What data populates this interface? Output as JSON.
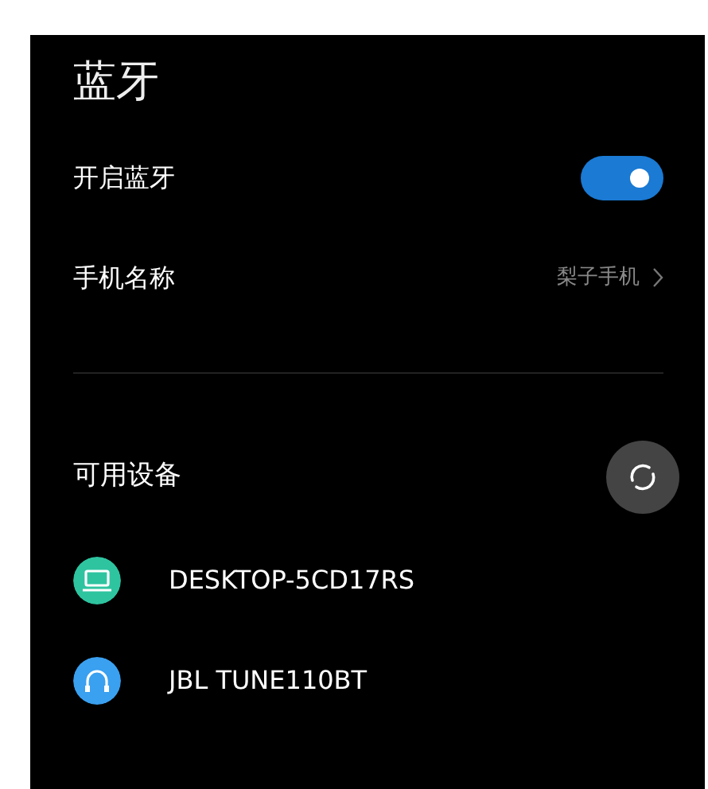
{
  "title": "蓝牙",
  "bluetooth": {
    "label": "开启蓝牙",
    "on": true
  },
  "phone_name": {
    "label": "手机名称",
    "value": "梨子手机"
  },
  "available": {
    "heading": "可用设备"
  },
  "devices": [
    {
      "name": "DESKTOP-5CD17RS",
      "kind": "computer",
      "color": "#2ec4a0"
    },
    {
      "name": "JBL TUNE110BT",
      "kind": "headphones",
      "color": "#3aa0f0"
    }
  ]
}
